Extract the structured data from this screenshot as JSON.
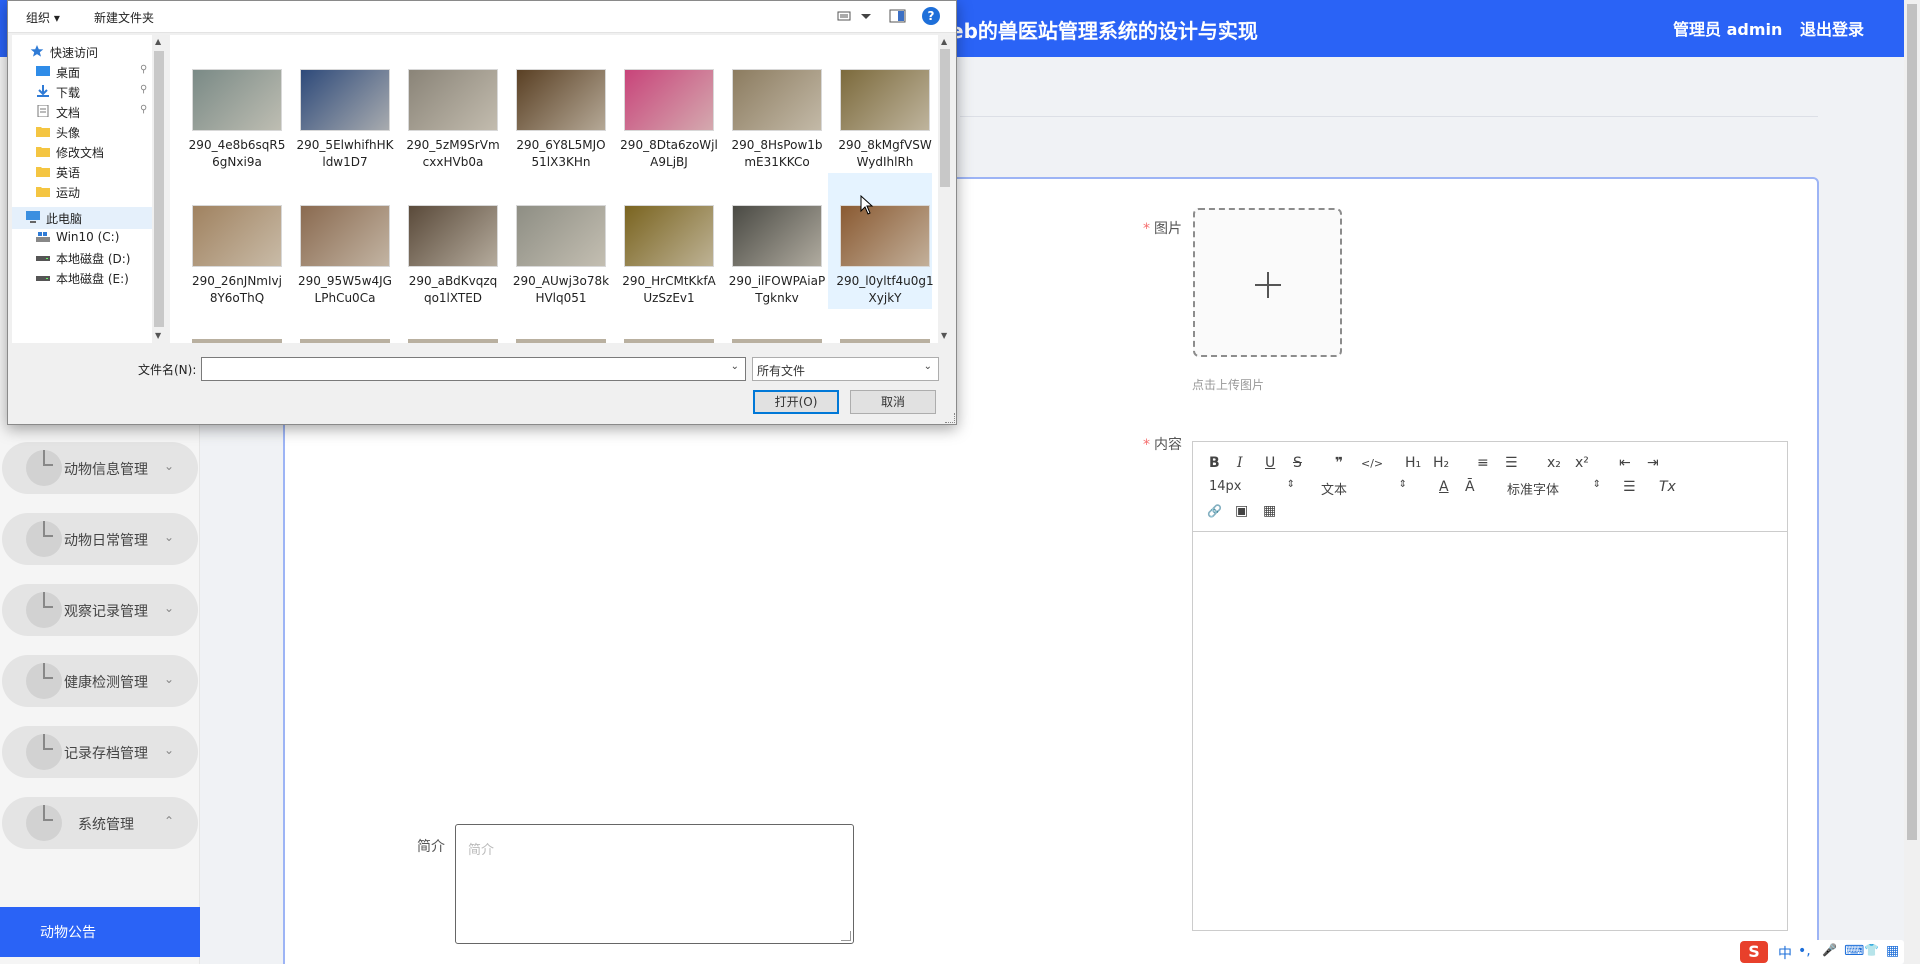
{
  "header": {
    "title": "eb的兽医站管理系统的设计与实现",
    "user_label": "管理员 admin",
    "logout": "退出登录"
  },
  "sidebar": {
    "items": [
      {
        "label": "动物信息管理",
        "arrow": "⌄"
      },
      {
        "label": "动物日常管理",
        "arrow": "⌄"
      },
      {
        "label": "观察记录管理",
        "arrow": "⌄"
      },
      {
        "label": "健康检测管理",
        "arrow": "⌄"
      },
      {
        "label": "记录存档管理",
        "arrow": "⌄"
      },
      {
        "label": "系统管理",
        "arrow": "⌃"
      }
    ],
    "active_item": "动物公告"
  },
  "form": {
    "image_label": "图片",
    "upload_tip": "点击上传图片",
    "content_label": "内容",
    "intro_label": "简介",
    "intro_placeholder": "简介",
    "required_mark": "*"
  },
  "editor": {
    "font_size": "14px",
    "block_type": "文本",
    "font_family": "标准字体",
    "buttons": {
      "bold": "B",
      "italic": "I",
      "underline": "U",
      "strike": "S",
      "quote": "❞",
      "code": "</>",
      "h1": "H₁",
      "h2": "H₂",
      "ordered_list": "≡",
      "bullet_list": "☰",
      "subscript": "x₂",
      "superscript": "x²",
      "outdent": "⇤",
      "indent": "⇥",
      "color": "A",
      "background": "Ā",
      "align": "☰",
      "clean": "Tx",
      "link": "🔗",
      "image": "▣",
      "video": "▦"
    }
  },
  "dialog": {
    "toolbar": {
      "organize": "组织 ▾",
      "new_folder": "新建文件夹",
      "help": "?"
    },
    "nav": [
      {
        "label": "快速访问",
        "icon": "star-icon",
        "pinned": false
      },
      {
        "label": "桌面",
        "icon": "desktop-folder-icon",
        "pinned": true
      },
      {
        "label": "下载",
        "icon": "download-folder-icon",
        "pinned": true
      },
      {
        "label": "文档",
        "icon": "document-folder-icon",
        "pinned": true
      },
      {
        "label": "头像",
        "icon": "folder-icon",
        "pinned": false
      },
      {
        "label": "修改文档",
        "icon": "folder-icon",
        "pinned": false
      },
      {
        "label": "英语",
        "icon": "folder-icon",
        "pinned": false
      },
      {
        "label": "运动",
        "icon": "folder-icon",
        "pinned": false
      },
      {
        "label": "此电脑",
        "icon": "computer-icon",
        "pinned": false
      },
      {
        "label": "Win10 (C:)",
        "icon": "windows-drive-icon",
        "pinned": false
      },
      {
        "label": "本地磁盘 (D:)",
        "icon": "drive-icon",
        "pinned": false
      },
      {
        "label": "本地磁盘 (E:)",
        "icon": "drive-icon",
        "pinned": false
      }
    ],
    "files": [
      {
        "line1": "290_4e8b6sqR5",
        "line2": "6gNxi9a",
        "color": "#7a8a86"
      },
      {
        "line1": "290_5ElwhifhHK",
        "line2": "ldw1D7",
        "color": "#2e4a7a"
      },
      {
        "line1": "290_5zM9SrVm",
        "line2": "cxxHVb0a",
        "color": "#8a8478"
      },
      {
        "line1": "290_6Y8L5MJO",
        "line2": "51lX3KHn",
        "color": "#5a4024"
      },
      {
        "line1": "290_8Dta6zoWjl",
        "line2": "A9LjBJ",
        "color": "#c8447a"
      },
      {
        "line1": "290_8HsPow1b",
        "line2": "mE31KKCo",
        "color": "#8c7c60"
      },
      {
        "line1": "290_8kMgfVSW",
        "line2": "WydIhlRh",
        "color": "#7c6a3c"
      },
      {
        "line1": "290_26nJNmIvj",
        "line2": "8Y6oThQ",
        "color": "#a08260"
      },
      {
        "line1": "290_95W5w4JG",
        "line2": "LPhCu0Ca",
        "color": "#8a6a50"
      },
      {
        "line1": "290_aBdKvqzq",
        "line2": "qo1lXTED",
        "color": "#5a4a3a"
      },
      {
        "line1": "290_AUwj3o78k",
        "line2": "HVlq051",
        "color": "#8e8e84"
      },
      {
        "line1": "290_HrCMtKkfA",
        "line2": "UzSzEv1",
        "color": "#7a6420"
      },
      {
        "line1": "290_ilFOWPAiaP",
        "line2": "Tgknkv",
        "color": "#4a4a44"
      },
      {
        "line1": "290_l0yltf4u0g1",
        "line2": "XyjkY",
        "color": "#8a5a32"
      }
    ],
    "filename_label": "文件名(N):",
    "filename_value": "",
    "filetype_value": "所有文件",
    "open_button": "打开(O)",
    "cancel_button": "取消"
  },
  "ime": {
    "lang": "中",
    "punct": "•,",
    "mic": "🎤",
    "keyboard": "⌨",
    "skin": "👕",
    "grid": "▦",
    "logo": "S"
  }
}
